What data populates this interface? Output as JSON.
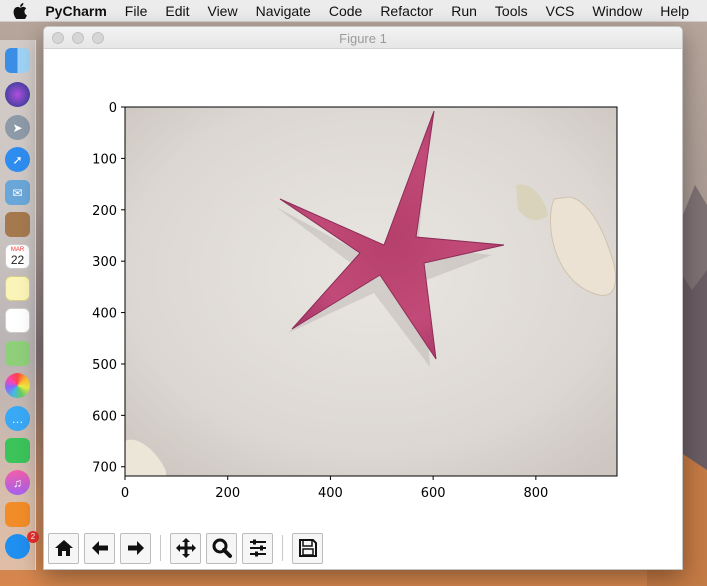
{
  "menubar": {
    "app": "PyCharm",
    "items": [
      "File",
      "Edit",
      "View",
      "Navigate",
      "Code",
      "Refactor",
      "Run",
      "Tools",
      "VCS",
      "Window",
      "Help"
    ]
  },
  "dock": {
    "icons": [
      "finder-icon",
      "siri-icon",
      "launchpad-icon",
      "safari-icon",
      "mail-icon",
      "contacts-icon",
      "calendar-icon",
      "notes-icon",
      "reminders-icon",
      "maps-icon",
      "photos-icon",
      "messages-icon",
      "facetime-icon",
      "itunes-icon",
      "ibooks-icon",
      "app-store-icon"
    ],
    "calendar": {
      "month": "MAR",
      "day": "22"
    },
    "app_store_badge": "2"
  },
  "window": {
    "title": "Figure 1"
  },
  "chart_data": {
    "type": "image",
    "x_ticks": [
      "0",
      "200",
      "400",
      "600",
      "800"
    ],
    "y_ticks": [
      "0",
      "100",
      "200",
      "300",
      "400",
      "500",
      "600",
      "700"
    ],
    "xlim": [
      0,
      958
    ],
    "ylim": [
      0,
      718
    ],
    "y_inverted": true,
    "image_content": "starfish"
  },
  "toolbar": {
    "buttons": [
      "home-button",
      "back-button",
      "forward-button",
      "pan-button",
      "zoom-button",
      "configure-subplots-button",
      "save-button"
    ]
  }
}
